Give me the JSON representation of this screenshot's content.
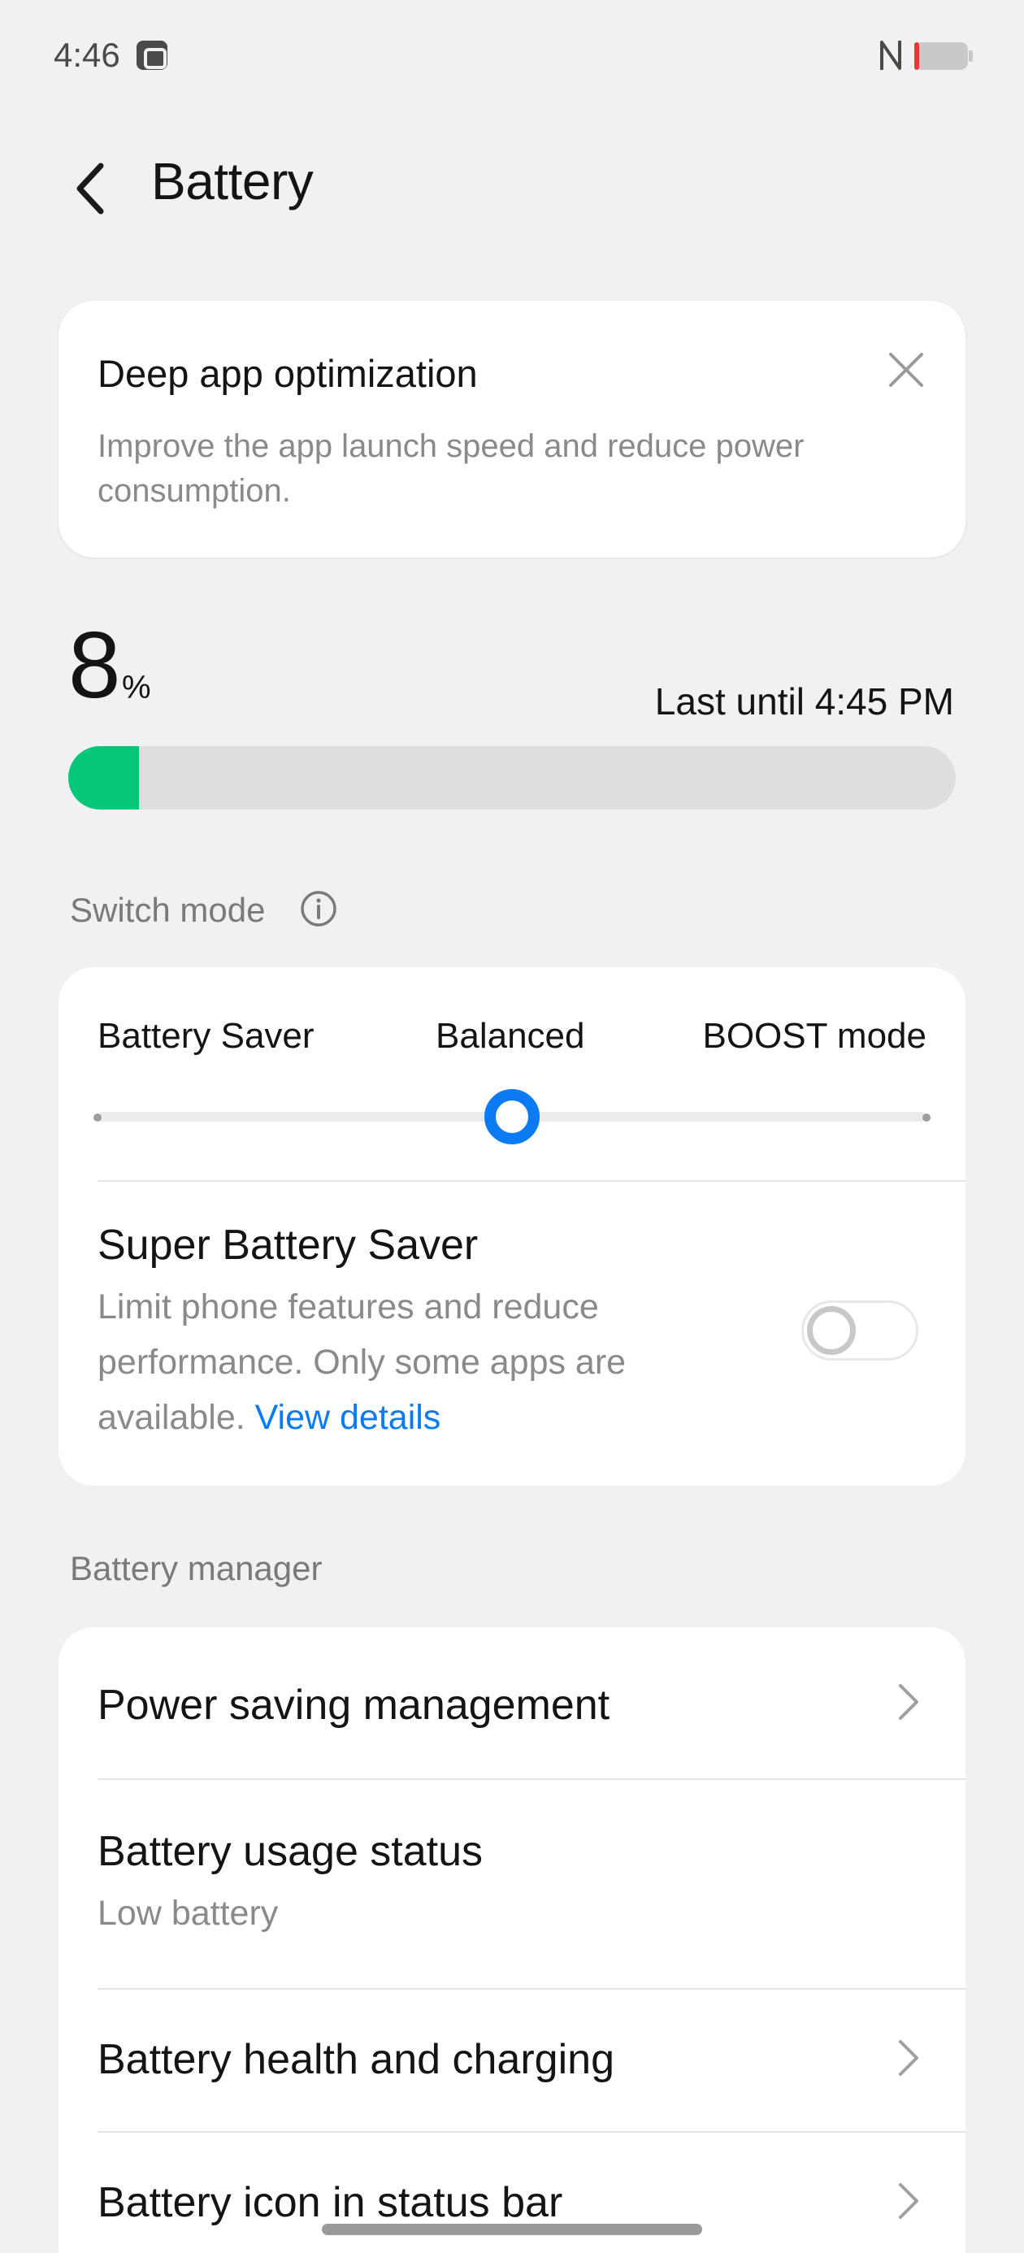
{
  "status_bar": {
    "time": "4:46",
    "battery_level_fraction": 0.08,
    "battery_color": "#e53935"
  },
  "header": {
    "title": "Battery",
    "back_icon": "chevron-left-icon"
  },
  "optimization_card": {
    "title": "Deep app optimization",
    "description": "Improve the app launch speed and reduce power consumption.",
    "close_icon": "close-icon"
  },
  "battery_level": {
    "value": "8",
    "unit": "%",
    "estimate": "Last until 4:45 PM",
    "fraction": 0.08,
    "fill_color": "#06c777"
  },
  "switch_mode": {
    "label": "Switch mode",
    "info_icon": "info-icon",
    "options": [
      "Battery Saver",
      "Balanced",
      "BOOST mode"
    ],
    "selected": "Balanced",
    "accent_color": "#0a7bf3"
  },
  "super_battery_saver": {
    "title": "Super Battery Saver",
    "description": "Limit phone features and reduce performance. Only some apps are available.",
    "link": "View details",
    "enabled": false
  },
  "battery_manager": {
    "label": "Battery manager",
    "items": [
      {
        "title": "Power saving management",
        "subtitle": "",
        "chevron": true
      },
      {
        "title": "Battery usage status",
        "subtitle": "Low battery",
        "chevron": false
      },
      {
        "title": "Battery health and charging",
        "subtitle": "",
        "chevron": true
      },
      {
        "title": "Battery icon in status bar",
        "subtitle": "",
        "chevron": true
      }
    ]
  }
}
